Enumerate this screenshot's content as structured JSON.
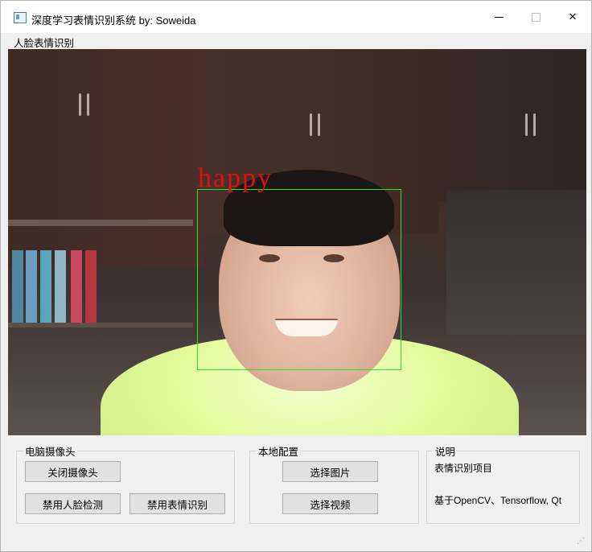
{
  "window": {
    "title": "深度学习表情识别系统 by: Soweida",
    "controls": {
      "minimize": "minimize-icon",
      "maximize": "maximize-icon",
      "close": "×"
    }
  },
  "menu": {
    "items": [
      {
        "label": "人脸表情识别"
      }
    ]
  },
  "video": {
    "detected_emotion": "happy",
    "box_color": "#33dd33",
    "label_color": "#e01010"
  },
  "groups": {
    "camera": {
      "title": "电脑摄像头",
      "close_camera": "关闭摄像头",
      "disable_face_detect": "禁用人脸检测",
      "disable_expression": "禁用表情识别"
    },
    "local": {
      "title": "本地配置",
      "select_image": "选择图片",
      "select_video": "选择视频"
    },
    "info": {
      "title": "说明",
      "line1": "表情识别项目",
      "line2": "基于OpenCV、Tensorflow, Qt"
    }
  }
}
